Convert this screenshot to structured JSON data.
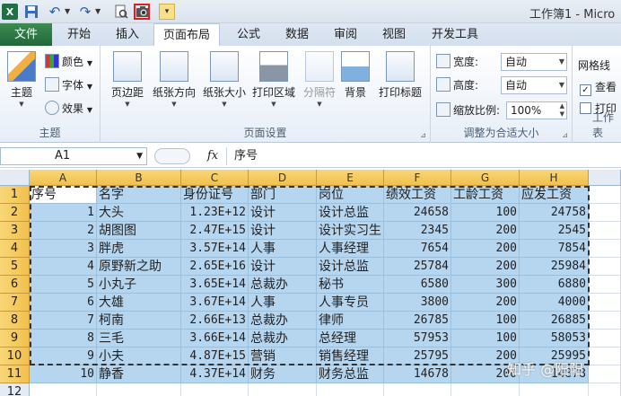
{
  "title": "工作簿1 - Micro",
  "tabs": [
    "文件",
    "开始",
    "插入",
    "页面布局",
    "公式",
    "数据",
    "审阅",
    "视图",
    "开发工具"
  ],
  "ribbon": {
    "theme_group": {
      "label": "主题",
      "big_button": "主题",
      "colors": "颜色",
      "fonts": "字体",
      "effects": "效果"
    },
    "page_setup_group": {
      "label": "页面设置",
      "buttons": [
        "页边距",
        "纸张方向",
        "纸张大小",
        "打印区域",
        "分隔符",
        "背景",
        "打印标题"
      ]
    },
    "scale_group": {
      "label": "调整为合适大小",
      "width_label": "宽度:",
      "width_value": "自动",
      "height_label": "高度:",
      "height_value": "自动",
      "scale_label": "缩放比例:",
      "scale_value": "100%"
    },
    "sheet_options_group": {
      "label": "工作表",
      "gridlines": "网格线",
      "view": "查看",
      "print": "打印"
    }
  },
  "formula_bar": {
    "name_box": "A1",
    "fx": "fx",
    "content": "序号"
  },
  "columns": [
    "A",
    "B",
    "C",
    "D",
    "E",
    "F",
    "G",
    "H"
  ],
  "rows": [
    "1",
    "2",
    "3",
    "4",
    "5",
    "6",
    "7",
    "8",
    "9",
    "10",
    "11",
    "12"
  ],
  "table": [
    [
      "序号",
      "名字",
      "身份证号",
      "部门",
      "岗位",
      "绩效工资",
      "工龄工资",
      "应发工资"
    ],
    [
      "1",
      "大头",
      "1.23E+12",
      "设计",
      "设计总监",
      "24658",
      "100",
      "24758"
    ],
    [
      "2",
      "胡图图",
      "2.47E+15",
      "设计",
      "设计实习生",
      "2345",
      "200",
      "2545"
    ],
    [
      "3",
      "胖虎",
      "3.57E+14",
      "人事",
      "人事经理",
      "7654",
      "200",
      "7854"
    ],
    [
      "4",
      "原野新之助",
      "2.65E+16",
      "设计",
      "设计总监",
      "25784",
      "200",
      "25984"
    ],
    [
      "5",
      "小丸子",
      "3.65E+14",
      "总裁办",
      "秘书",
      "6580",
      "300",
      "6880"
    ],
    [
      "6",
      "大雄",
      "3.67E+14",
      "人事",
      "人事专员",
      "3800",
      "200",
      "4000"
    ],
    [
      "7",
      "柯南",
      "2.66E+13",
      "总裁办",
      "律师",
      "26785",
      "100",
      "26885"
    ],
    [
      "8",
      "三毛",
      "3.66E+14",
      "总裁办",
      "总经理",
      "57953",
      "100",
      "58053"
    ],
    [
      "9",
      "小夫",
      "4.87E+15",
      "营销",
      "销售经理",
      "25795",
      "200",
      "25995"
    ],
    [
      "10",
      "静香",
      "4.37E+14",
      "财务",
      "财务总监",
      "14678",
      "200",
      "14878"
    ]
  ],
  "watermark": "知乎 @阳阳"
}
